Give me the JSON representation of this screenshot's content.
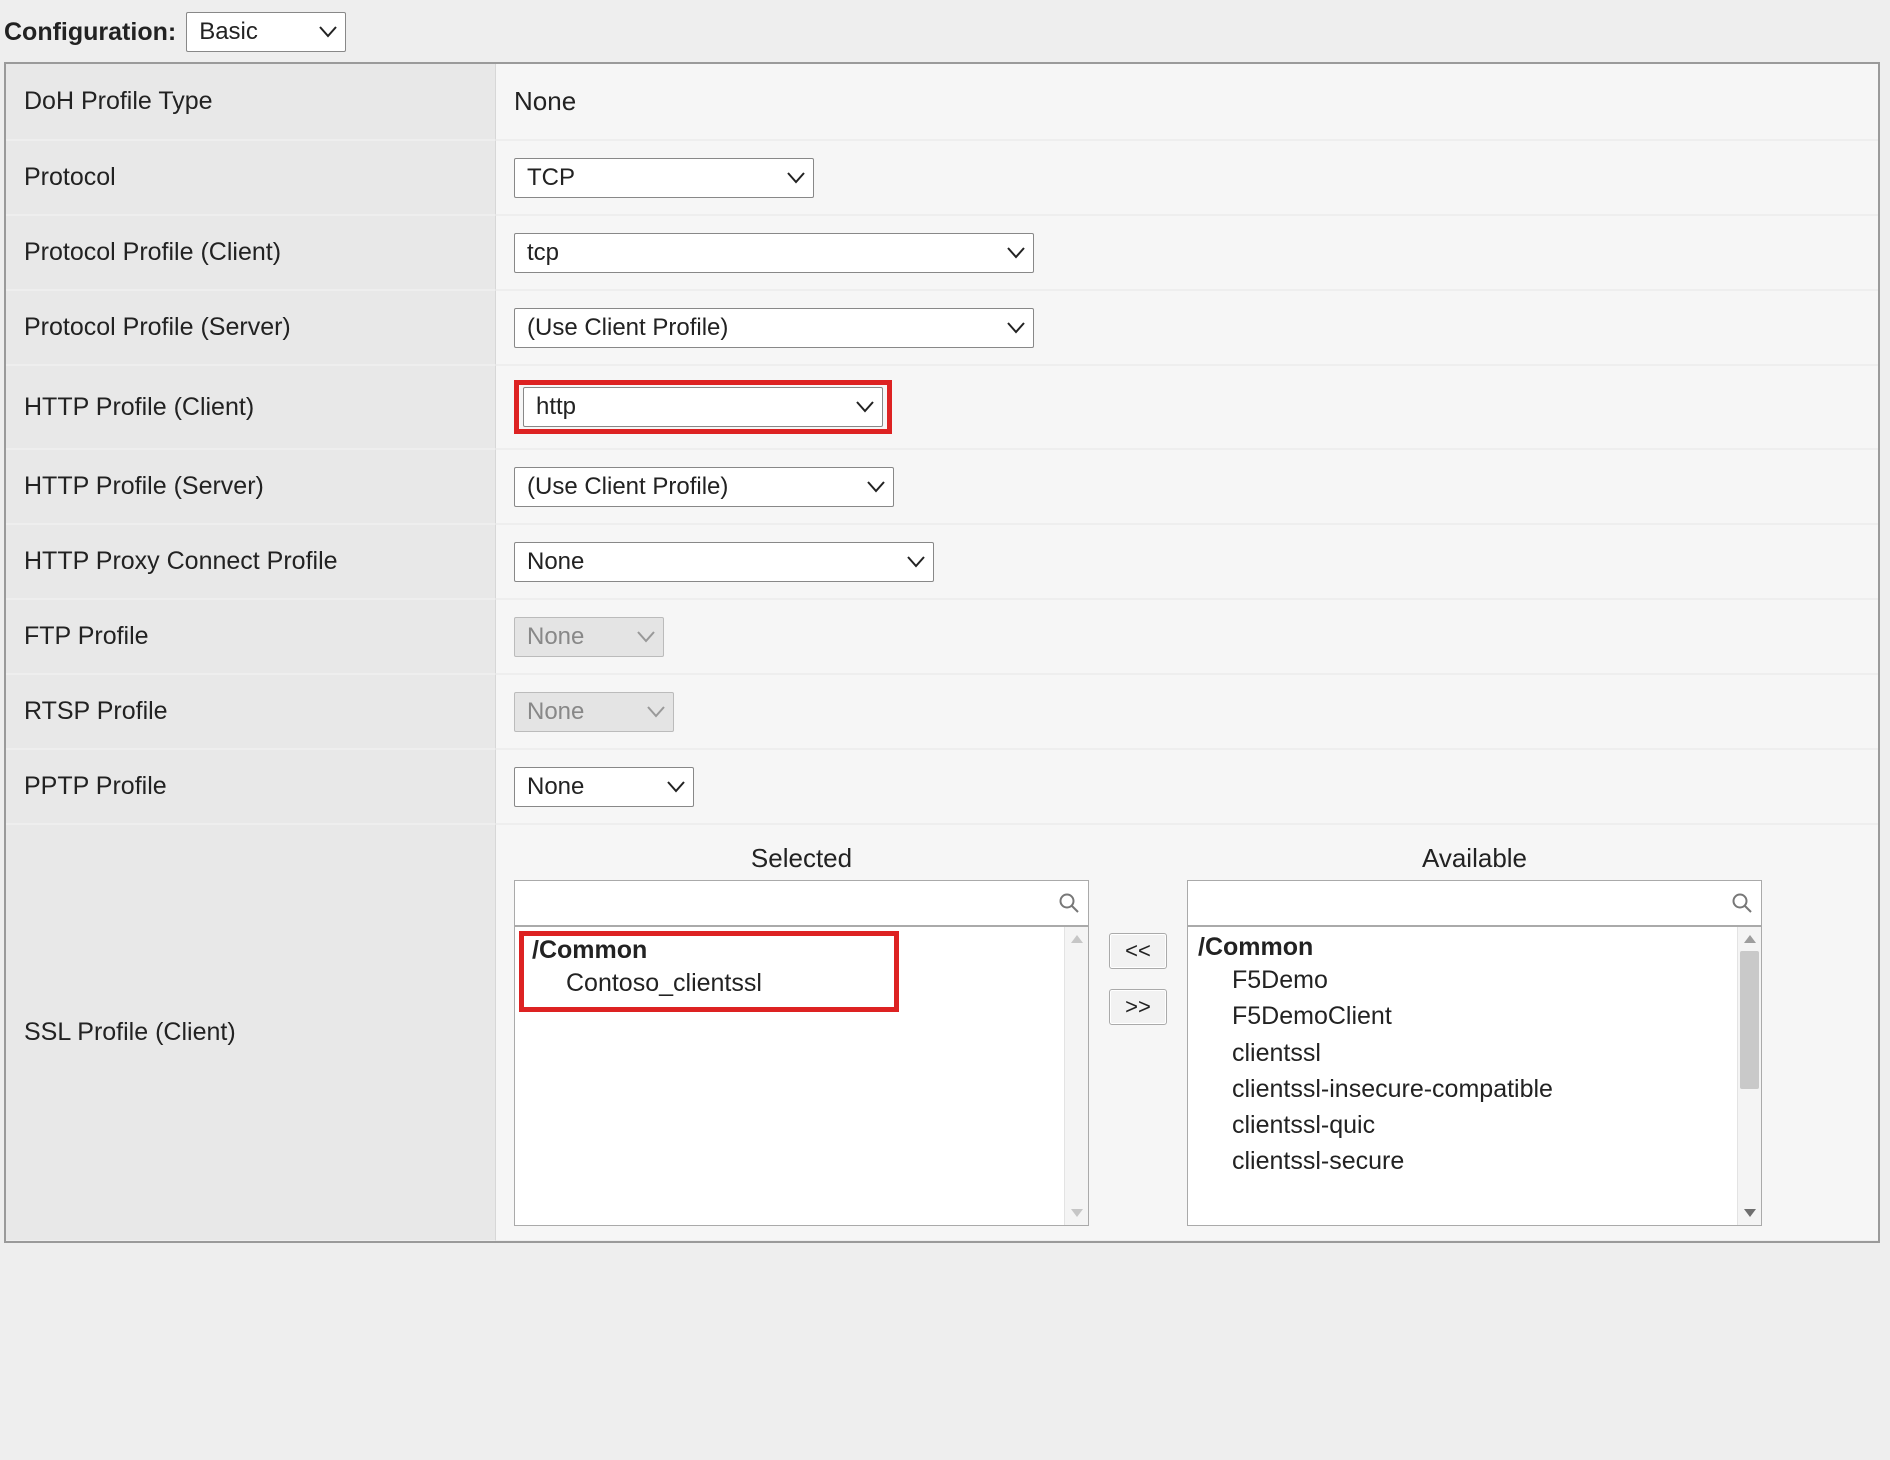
{
  "header": {
    "configuration_label": "Configuration:",
    "configuration_value": "Basic"
  },
  "rows": {
    "doh_profile_type": {
      "label": "DoH Profile Type",
      "value": "None"
    },
    "protocol": {
      "label": "Protocol",
      "value": "TCP"
    },
    "protocol_profile_client": {
      "label": "Protocol Profile (Client)",
      "value": "tcp"
    },
    "protocol_profile_server": {
      "label": "Protocol Profile (Server)",
      "value": "(Use Client Profile)"
    },
    "http_profile_client": {
      "label": "HTTP Profile (Client)",
      "value": "http"
    },
    "http_profile_server": {
      "label": "HTTP Profile (Server)",
      "value": "(Use Client Profile)"
    },
    "http_proxy_connect": {
      "label": "HTTP Proxy Connect Profile",
      "value": "None"
    },
    "ftp_profile": {
      "label": "FTP Profile",
      "value": "None"
    },
    "rtsp_profile": {
      "label": "RTSP Profile",
      "value": "None"
    },
    "pptp_profile": {
      "label": "PPTP Profile",
      "value": "None"
    },
    "ssl_profile_client": {
      "label": "SSL Profile (Client)",
      "selected_header": "Selected",
      "available_header": "Available",
      "selected_group": "/Common",
      "selected_items": [
        "Contoso_clientssl"
      ],
      "available_group": "/Common",
      "available_items": [
        "F5Demo",
        "F5DemoClient",
        "clientssl",
        "clientssl-insecure-compatible",
        "clientssl-quic",
        "clientssl-secure"
      ],
      "move_left_label": "<<",
      "move_right_label": ">>"
    }
  },
  "colors": {
    "highlight": "#d22"
  }
}
